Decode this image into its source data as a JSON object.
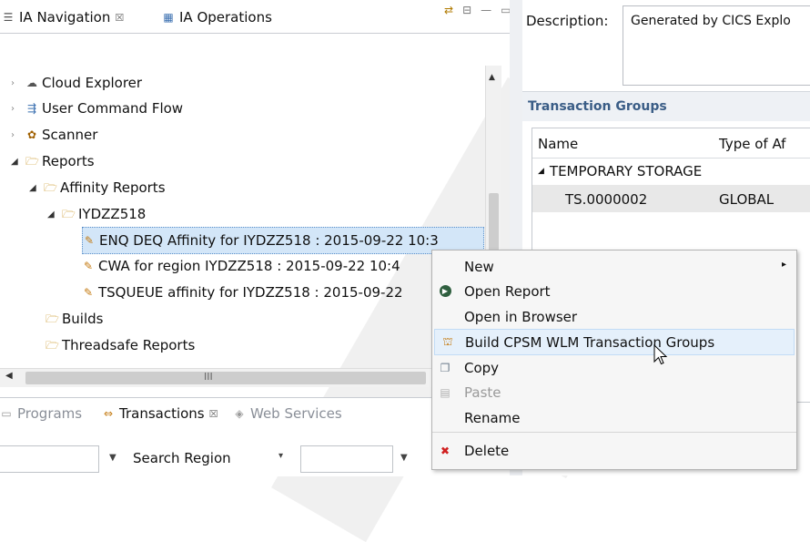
{
  "left_panel": {
    "tabs": [
      {
        "label": "IA Navigation",
        "close": "☒"
      },
      {
        "label": "IA Operations"
      }
    ],
    "tree": [
      {
        "label": "Cloud Explorer"
      },
      {
        "label": "User Command Flow"
      },
      {
        "label": "Scanner"
      },
      {
        "label": "Reports"
      },
      {
        "label": "Affinity Reports"
      },
      {
        "label": "IYDZZ518"
      },
      {
        "label": "ENQ DEQ Affinity for IYDZZ518 : 2015-09-22 10:3"
      },
      {
        "label": "CWA for region IYDZZ518 : 2015-09-22 10:4"
      },
      {
        "label": "TSQUEUE affinity for IYDZZ518 : 2015-09-22"
      },
      {
        "label": "Builds"
      },
      {
        "label": "Threadsafe Reports"
      }
    ],
    "hscroll_grip": "III"
  },
  "bottom_panel": {
    "tabs": [
      {
        "label": "Programs"
      },
      {
        "label": "Transactions",
        "close": "☒"
      },
      {
        "label": "Web Services"
      }
    ],
    "search_label": "Search Region"
  },
  "right_panel": {
    "description_label": "Description:",
    "description_value": "Generated by CICS Explo",
    "section_title": "Transaction Groups",
    "columns": [
      "Name",
      "Type of Af"
    ],
    "group_label": "TEMPORARY STORAGE",
    "rows": [
      {
        "name": "TS.0000002",
        "type": "GLOBAL"
      }
    ]
  },
  "context_menu": {
    "items": [
      {
        "label": "New",
        "arrow": "▸"
      },
      {
        "label": "Open Report"
      },
      {
        "label": "Open in Browser"
      },
      {
        "label": "Build CPSM WLM Transaction Groups"
      },
      {
        "label": "Copy"
      },
      {
        "label": "Paste"
      },
      {
        "label": "Rename"
      },
      {
        "label": "Delete"
      }
    ]
  },
  "colors": {
    "selection": "#d3e6f8",
    "section_title": "#3a5d86",
    "menu_highlight": "#e5f0fb",
    "delete_icon": "#d02020"
  }
}
